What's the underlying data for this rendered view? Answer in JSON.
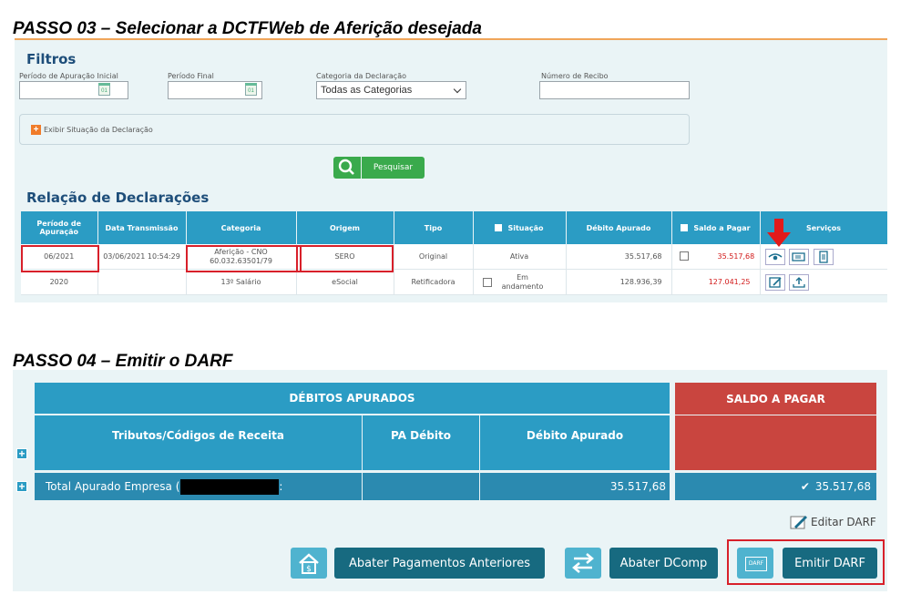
{
  "step3": {
    "heading": "PASSO 03 – Selecionar a DCTFWeb de Aferição desejada",
    "filters": {
      "title": "Filtros",
      "period_start_label": "Período de Apuração Inicial",
      "period_end_label": "Período Final",
      "category_label": "Categoria da Declaração",
      "category_value": "Todas as Categorias",
      "receipt_label": "Número de Recibo",
      "calendar_label": "01",
      "show_status_label": "Exibir Situação da Declaração",
      "search_label": "Pesquisar"
    },
    "declarations": {
      "title": "Relação de Declarações",
      "columns": [
        "Período de Apuração",
        "Data Transmissão",
        "Categoria",
        "Origem",
        "Tipo",
        "Situação",
        "Débito Apurado",
        "Saldo a Pagar",
        "Serviços"
      ],
      "rows": [
        {
          "periodo": "06/2021",
          "data": "03/06/2021 10:54:29",
          "categoria": "Aferição - CNO 60.032.63501/79",
          "origem": "SERO",
          "tipo": "Original",
          "situacao": "Ativa",
          "debito": "35.517,68",
          "saldo": "35.517,68"
        },
        {
          "periodo": "2020",
          "data": "",
          "categoria": "13º Salário",
          "origem": "eSocial",
          "tipo": "Retificadora",
          "situacao": "Em andamento",
          "debito": "128.936,39",
          "saldo": "127.041,25"
        }
      ]
    },
    "colors": {
      "header_blue": "#2b9cc4",
      "highlight_red": "#d8202a",
      "value_red": "#d21a1a"
    }
  },
  "step4": {
    "heading": "PASSO 04 – Emitir o DARF",
    "debitos_header": "DÉBITOS APURADOS",
    "saldo_header": "SALDO A PAGAR",
    "col_tributos": "Tributos/Códigos de Receita",
    "col_pa": "PA Débito",
    "col_debito": "Débito Apurado",
    "total_label": "Total Apurado Empresa (",
    "total_suffix": ":",
    "total_debito": "35.517,68",
    "total_saldo": "35.517,68",
    "check_mark": "✔",
    "edit_darf": "Editar DARF",
    "btn_abater_pagamentos": "Abater Pagamentos Anteriores",
    "btn_abater_dcomp": "Abater DComp",
    "btn_emitir_darf": "Emitir DARF",
    "darf_icon_label": "DARF",
    "colors": {
      "saldo_red": "#c9453f",
      "button_teal": "#176a80",
      "icon_button": "#4fb3cf"
    }
  }
}
